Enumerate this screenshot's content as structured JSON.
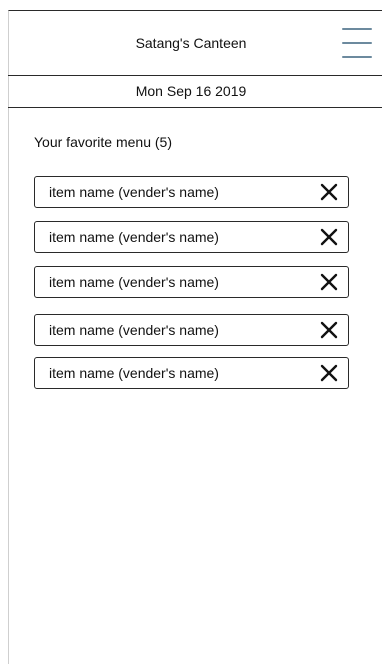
{
  "header": {
    "title": "Satang's Canteen",
    "menu_icon": "hamburger-menu-icon",
    "menu_color": "#6c8a9e"
  },
  "date_bar": {
    "date": "Mon Sep 16 2019"
  },
  "favorites": {
    "heading": "Your favorite menu (5)",
    "remove_icon": "close-icon",
    "items": [
      {
        "label": "item name (vender's name)"
      },
      {
        "label": "item name (vender's name)"
      },
      {
        "label": "item name (vender's name)"
      },
      {
        "label": "item name (vender's name)"
      },
      {
        "label": "item name (vender's name)"
      }
    ]
  }
}
